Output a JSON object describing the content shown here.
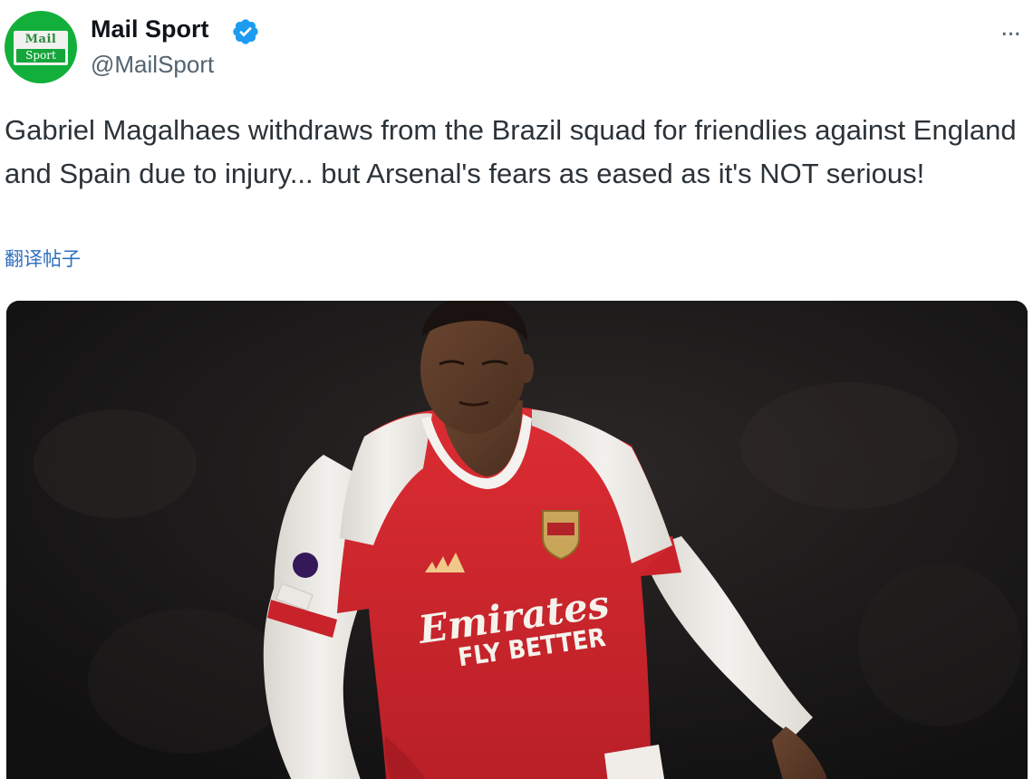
{
  "account": {
    "display_name": "Mail Sport",
    "handle": "@MailSport",
    "avatar_top": "Mail",
    "avatar_bottom": "Sport",
    "verified_icon": "verified-badge-icon",
    "more_icon": "more-options-icon",
    "more_glyph": "..."
  },
  "tweet": {
    "text": "Gabriel Magalhaes withdraws from the Brazil squad for friendlies against England and Spain due to injury... but Arsenal's fears as eased as it's NOT serious!",
    "translate_label": "翻译帖子"
  },
  "media": {
    "jersey_sponsor_line1": "Emirates",
    "jersey_sponsor_line2": "FLY BETTER",
    "colors": {
      "jersey_red": "#d8282f",
      "sleeve_white": "#f2f0ec",
      "background_dark": "#1c1a1a",
      "accent_blue": "#1d9bf0"
    }
  }
}
